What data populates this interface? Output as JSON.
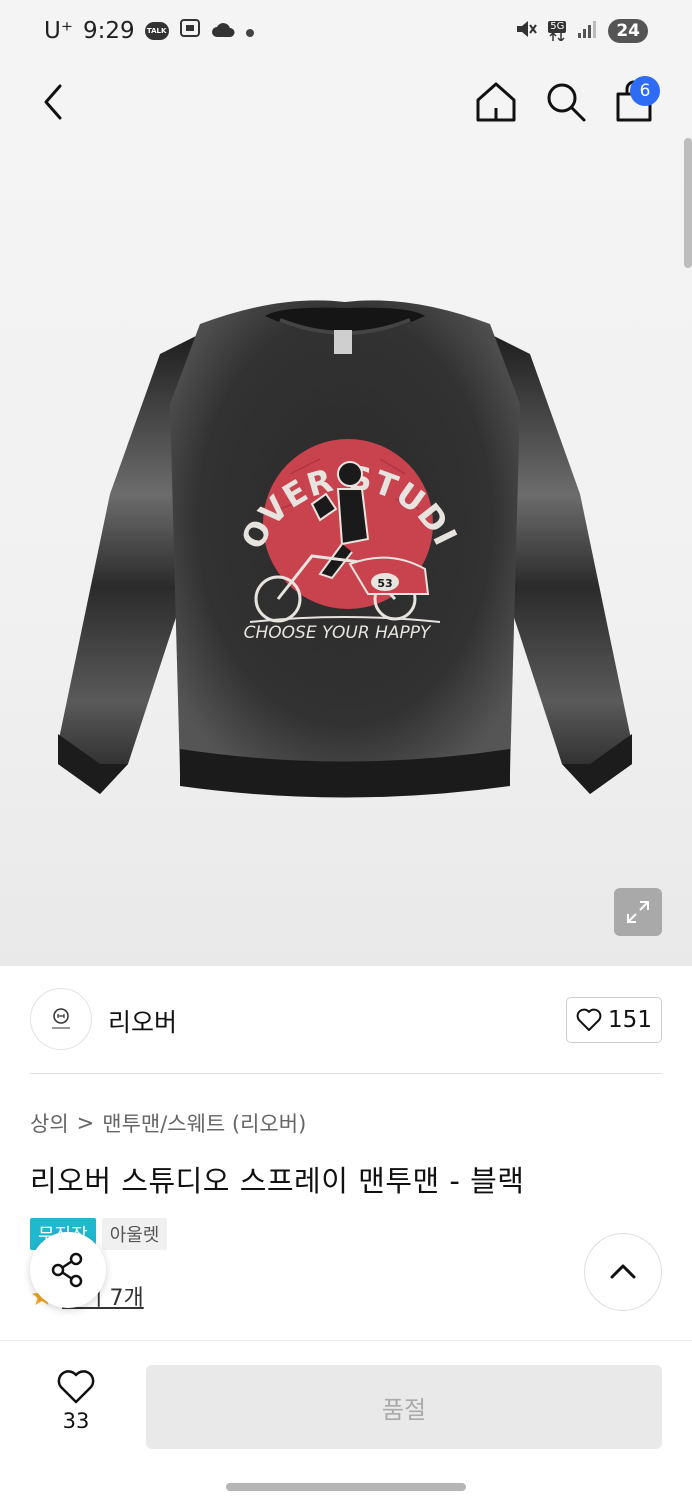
{
  "status_bar": {
    "carrier": "U⁺",
    "time": "9:29",
    "talk_label": "TALK",
    "network": "5G",
    "battery": "24"
  },
  "header": {
    "cart_count": "6"
  },
  "product_image": {
    "print_top": "REOVER STUDIOS",
    "print_bottom": "CHOOSE YOUR HAPPY",
    "bike_number": "53"
  },
  "brand": {
    "name": "리오버",
    "like_count": "151"
  },
  "breadcrumb": {
    "category": "상의",
    "separator": ">",
    "subcategory": "맨투맨/스웨트 (리오버)"
  },
  "product": {
    "title": "리오버 스튜디오 스프레이 맨투맨 - 블랙"
  },
  "tags": {
    "free_shipping": "무진장",
    "outlet": "아울렛"
  },
  "reviews": {
    "link_text": "후기 7개"
  },
  "bottom_bar": {
    "wish_count": "33",
    "action_label": "품절"
  },
  "colors": {
    "accent_blue": "#2f6cf6",
    "tag_cyan": "#1fb8cf",
    "star_orange": "#f5a623",
    "print_red": "#c9434f"
  }
}
